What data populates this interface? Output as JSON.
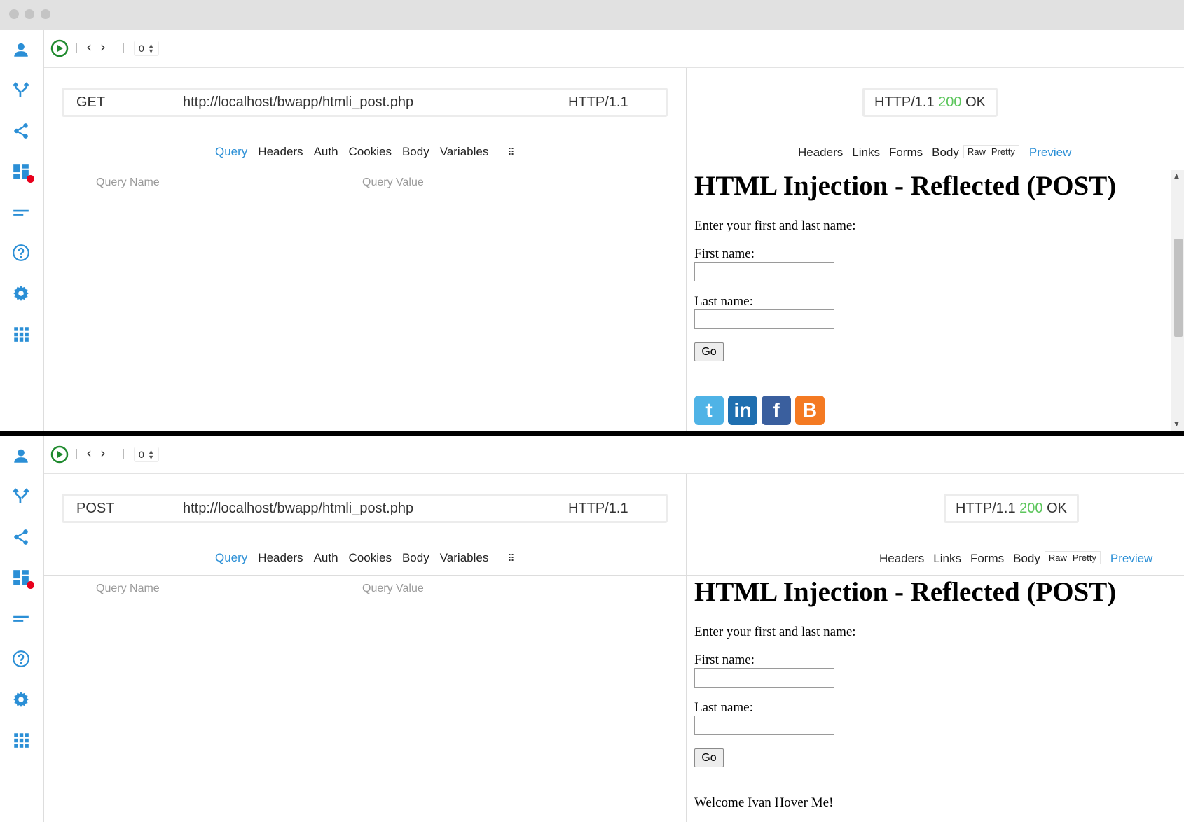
{
  "top": {
    "counter": "0",
    "request": {
      "method": "GET",
      "url": "http://localhost/bwapp/htmli_post.php",
      "protocol": "HTTP/1.1"
    },
    "req_tabs": [
      "Query",
      "Headers",
      "Auth",
      "Cookies",
      "Body",
      "Variables"
    ],
    "query_name_header": "Query Name",
    "query_value_header": "Query Value",
    "response": {
      "protocol": "HTTP/1.1",
      "code": "200",
      "text": "OK"
    },
    "resp_tabs": [
      "Headers",
      "Links",
      "Forms",
      "Body"
    ],
    "resp_sub": [
      "Raw",
      "Pretty"
    ],
    "preview_tab": "Preview",
    "preview": {
      "heading": "HTML Injection - Reflected (POST)",
      "intro": "Enter your first and last name:",
      "first_label": "First name:",
      "last_label": "Last name:",
      "go": "Go"
    }
  },
  "bottom": {
    "counter": "0",
    "request": {
      "method": "POST",
      "url": "http://localhost/bwapp/htmli_post.php",
      "protocol": "HTTP/1.1"
    },
    "req_tabs": [
      "Query",
      "Headers",
      "Auth",
      "Cookies",
      "Body",
      "Variables"
    ],
    "query_name_header": "Query Name",
    "query_value_header": "Query Value",
    "response": {
      "protocol": "HTTP/1.1",
      "code": "200",
      "text": "OK"
    },
    "resp_tabs": [
      "Headers",
      "Links",
      "Forms",
      "Body"
    ],
    "resp_sub": [
      "Raw",
      "Pretty"
    ],
    "preview_tab": "Preview",
    "preview": {
      "heading": "HTML Injection - Reflected (POST)",
      "intro": "Enter your first and last name:",
      "first_label": "First name:",
      "last_label": "Last name:",
      "go": "Go",
      "welcome": "Welcome Ivan Hover Me!"
    }
  },
  "sidebar_icons": [
    "user-icon",
    "fork-icon",
    "share-icon",
    "dashboard-icon",
    "lines-icon",
    "help-icon",
    "settings-icon",
    "apps-icon"
  ],
  "social_icons": [
    "twitter-icon",
    "linkedin-icon",
    "facebook-icon",
    "blogger-icon"
  ],
  "colors": {
    "accent": "#2b8fd6",
    "status_ok": "#5cc65c",
    "play": "#1f8a2e"
  }
}
